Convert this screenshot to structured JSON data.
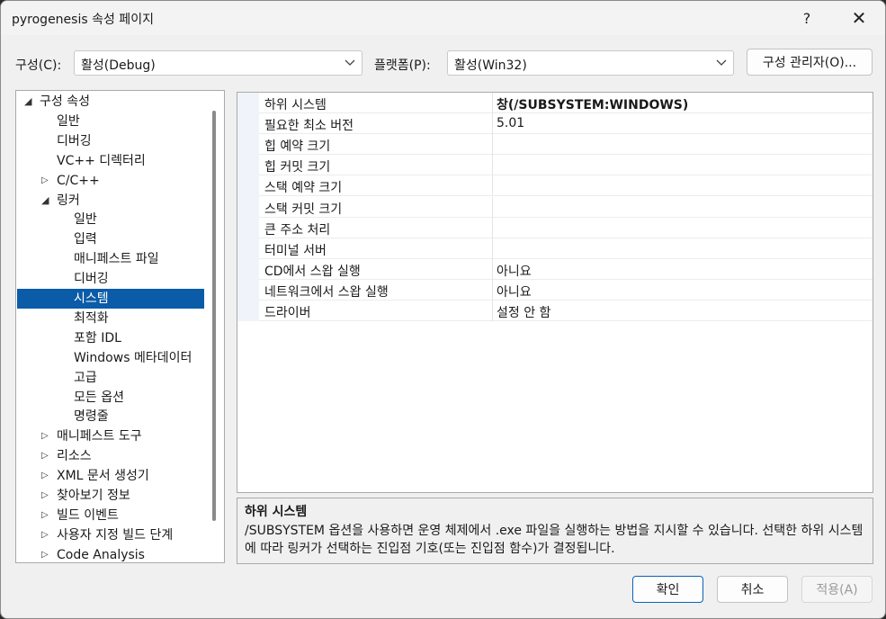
{
  "window": {
    "title": "pyrogenesis 속성 페이지",
    "help_glyph": "?",
    "close_glyph": "✕"
  },
  "config": {
    "label": "구성(C):",
    "value": "활성(Debug)"
  },
  "platform": {
    "label": "플랫폼(P):",
    "value": "활성(Win32)"
  },
  "config_manager_label": "구성 관리자(O)...",
  "tree": {
    "items": [
      {
        "label": "구성 속성",
        "level": 0,
        "arrow": "expanded"
      },
      {
        "label": "일반",
        "level": 1,
        "arrow": "none"
      },
      {
        "label": "디버깅",
        "level": 1,
        "arrow": "none"
      },
      {
        "label": "VC++ 디렉터리",
        "level": 1,
        "arrow": "none"
      },
      {
        "label": "C/C++",
        "level": 1,
        "arrow": "collapsed"
      },
      {
        "label": "링커",
        "level": 1,
        "arrow": "expanded"
      },
      {
        "label": "일반",
        "level": 2,
        "arrow": "none"
      },
      {
        "label": "입력",
        "level": 2,
        "arrow": "none"
      },
      {
        "label": "매니페스트 파일",
        "level": 2,
        "arrow": "none"
      },
      {
        "label": "디버깅",
        "level": 2,
        "arrow": "none"
      },
      {
        "label": "시스템",
        "level": 2,
        "arrow": "none",
        "selected": true
      },
      {
        "label": "최적화",
        "level": 2,
        "arrow": "none"
      },
      {
        "label": "포함 IDL",
        "level": 2,
        "arrow": "none"
      },
      {
        "label": "Windows 메타데이터",
        "level": 2,
        "arrow": "none"
      },
      {
        "label": "고급",
        "level": 2,
        "arrow": "none"
      },
      {
        "label": "모든 옵션",
        "level": 2,
        "arrow": "none"
      },
      {
        "label": "명령줄",
        "level": 2,
        "arrow": "none"
      },
      {
        "label": "매니페스트 도구",
        "level": 1,
        "arrow": "collapsed"
      },
      {
        "label": "리소스",
        "level": 1,
        "arrow": "collapsed"
      },
      {
        "label": "XML 문서 생성기",
        "level": 1,
        "arrow": "collapsed"
      },
      {
        "label": "찾아보기 정보",
        "level": 1,
        "arrow": "collapsed"
      },
      {
        "label": "빌드 이벤트",
        "level": 1,
        "arrow": "collapsed"
      },
      {
        "label": "사용자 지정 빌드 단계",
        "level": 1,
        "arrow": "collapsed"
      },
      {
        "label": "Code Analysis",
        "level": 1,
        "arrow": "collapsed"
      }
    ]
  },
  "properties": [
    {
      "name": "하위 시스템",
      "value": "창(/SUBSYSTEM:WINDOWS)"
    },
    {
      "name": "필요한 최소 버전",
      "value": "5.01"
    },
    {
      "name": "힙 예약 크기",
      "value": ""
    },
    {
      "name": "힙 커밋 크기",
      "value": ""
    },
    {
      "name": "스택 예약 크기",
      "value": ""
    },
    {
      "name": "스택 커밋 크기",
      "value": ""
    },
    {
      "name": "큰 주소 처리",
      "value": ""
    },
    {
      "name": "터미널 서버",
      "value": ""
    },
    {
      "name": "CD에서 스왑 실행",
      "value": "아니요"
    },
    {
      "name": "네트워크에서 스왑 실행",
      "value": "아니요"
    },
    {
      "name": "드라이버",
      "value": "설정 안 함"
    }
  ],
  "description": {
    "title": "하위 시스템",
    "body": "/SUBSYSTEM 옵션을 사용하면 운영 체제에서 .exe 파일을 실행하는 방법을 지시할 수 있습니다. 선택한 하위 시스템에 따라 링커가 선택하는 진입점 기호(또는 진입점 함수)가 결정됩니다."
  },
  "buttons": {
    "ok": "확인",
    "cancel": "취소",
    "apply": "적용(A)"
  },
  "icons": {
    "dropdown": "chevron-down-icon",
    "expanded": "triangle-expanded-icon",
    "collapsed": "triangle-collapsed-icon"
  },
  "colors": {
    "selection": "#0a5ba8",
    "primary_border": "#0b61b8"
  }
}
